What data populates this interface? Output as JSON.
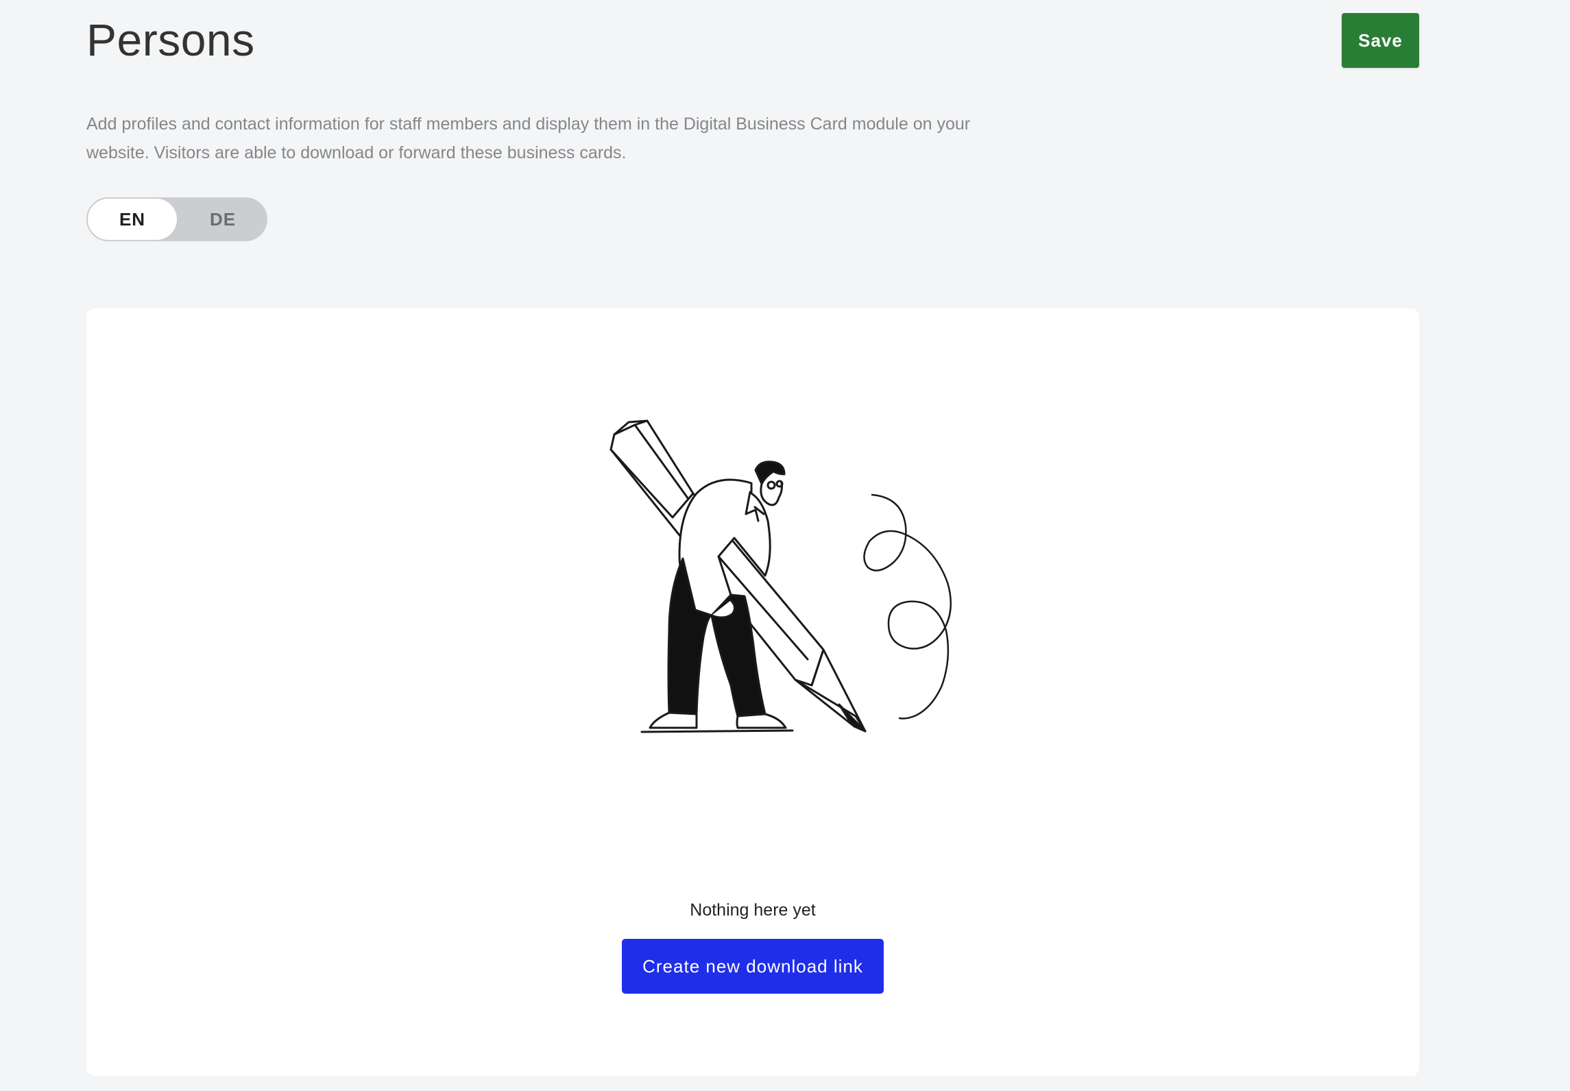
{
  "header": {
    "title": "Persons",
    "save_label": "Save"
  },
  "description": "Add profiles and contact information for staff members and display them in the Digital Business Card module on your website. Visitors are able to download or forward these business cards.",
  "language_toggle": {
    "options": [
      "EN",
      "DE"
    ],
    "selected": "EN"
  },
  "empty_state": {
    "message": "Nothing here yet",
    "button_label": "Create new download link",
    "illustration": "person-holding-pencil-illustration"
  },
  "colors": {
    "save": "#2a7d34",
    "primary": "#1f2ee8",
    "background": "#f4f5f7"
  }
}
